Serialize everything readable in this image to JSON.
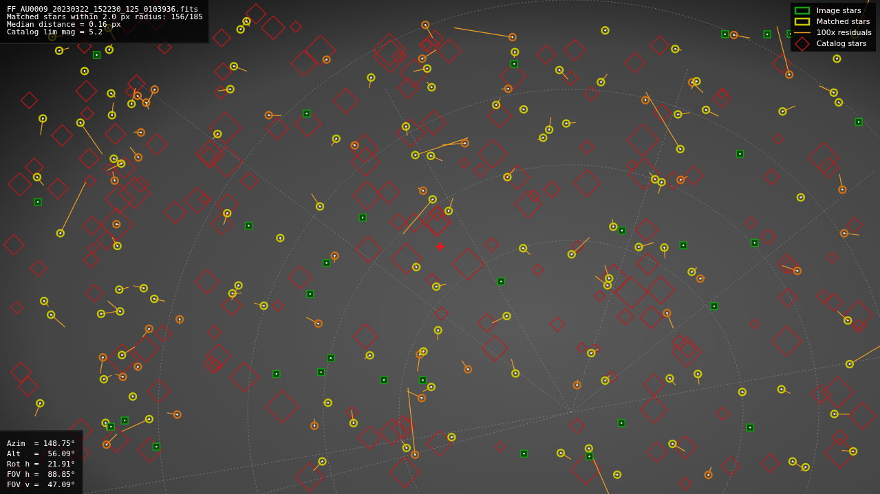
{
  "file_info": {
    "lines": [
      "FF_AU0009_20230322_152230_125_0103936.fits",
      "Matched stars within 2.0 px radius: 156/185",
      "Median distance = 0.16 px",
      "Catalog lim mag = 5.2"
    ]
  },
  "legend": {
    "items": [
      {
        "kind": "image",
        "label": "Image stars"
      },
      {
        "kind": "matched",
        "label": "Matched stars"
      },
      {
        "kind": "residual",
        "label": "100x residuals"
      },
      {
        "kind": "catalog",
        "label": "Catalog stars"
      }
    ]
  },
  "pointing": {
    "lines": [
      "Azim  = 148.75°",
      "Alt   =  56.09°",
      "Rot h =  21.91°",
      "FOV h =  88.85°",
      "FOV v =  47.09°"
    ]
  }
}
